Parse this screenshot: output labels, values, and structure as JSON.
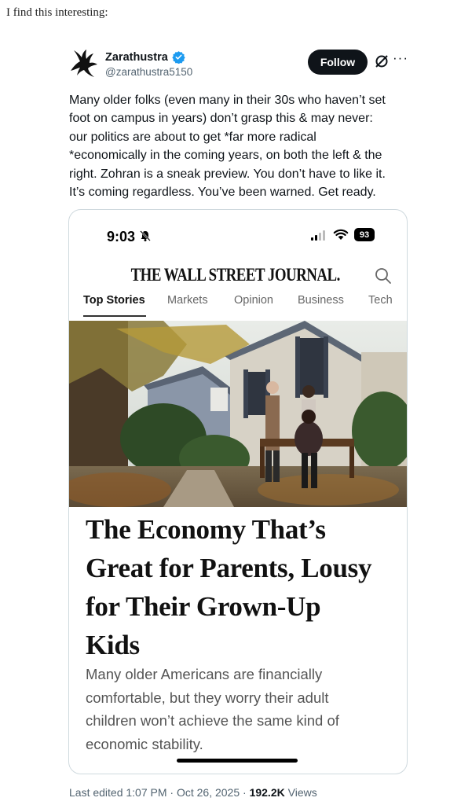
{
  "intro": "I find this interesting:",
  "author": {
    "name": "Zarathustra",
    "handle": "@zarathustra5150",
    "follow_label": "Follow",
    "avatar_icon": "bird-silhouette-icon",
    "verified_color": "#1d9bf0"
  },
  "tweet": {
    "lines": [
      "Many older folks (even many in their 30s who haven’t set",
      "foot on campus in years) don’t grasp this & may never:",
      "our politics are about to get *far more radical",
      "*economically in the coming years, on both the left & the",
      "right. Zohran is a sneak preview. You don’t have to like it.",
      "It’s coming regardless. You’ve been warned. Get ready."
    ]
  },
  "screenshot": {
    "time": "9:03",
    "battery": "93",
    "masthead": "THE WALL STREET JOURNAL.",
    "tabs": [
      "Top Stories",
      "Markets",
      "Opinion",
      "Business",
      "Tech"
    ],
    "active_tab": "Top Stories",
    "headline_lines": [
      "The Economy That’s",
      "Great for Parents, Lousy",
      "for Their Grown-Up",
      "Kids"
    ],
    "dek_lines": [
      "Many older Americans are financially",
      "comfortable, but they worry their adult",
      "children won’t achieve the same kind of",
      "economic stability."
    ]
  },
  "meta": {
    "edited": "Last edited 1:07 PM · Oct 26, 2025 · ",
    "views_count": "192.2K",
    "views_label": " Views"
  }
}
